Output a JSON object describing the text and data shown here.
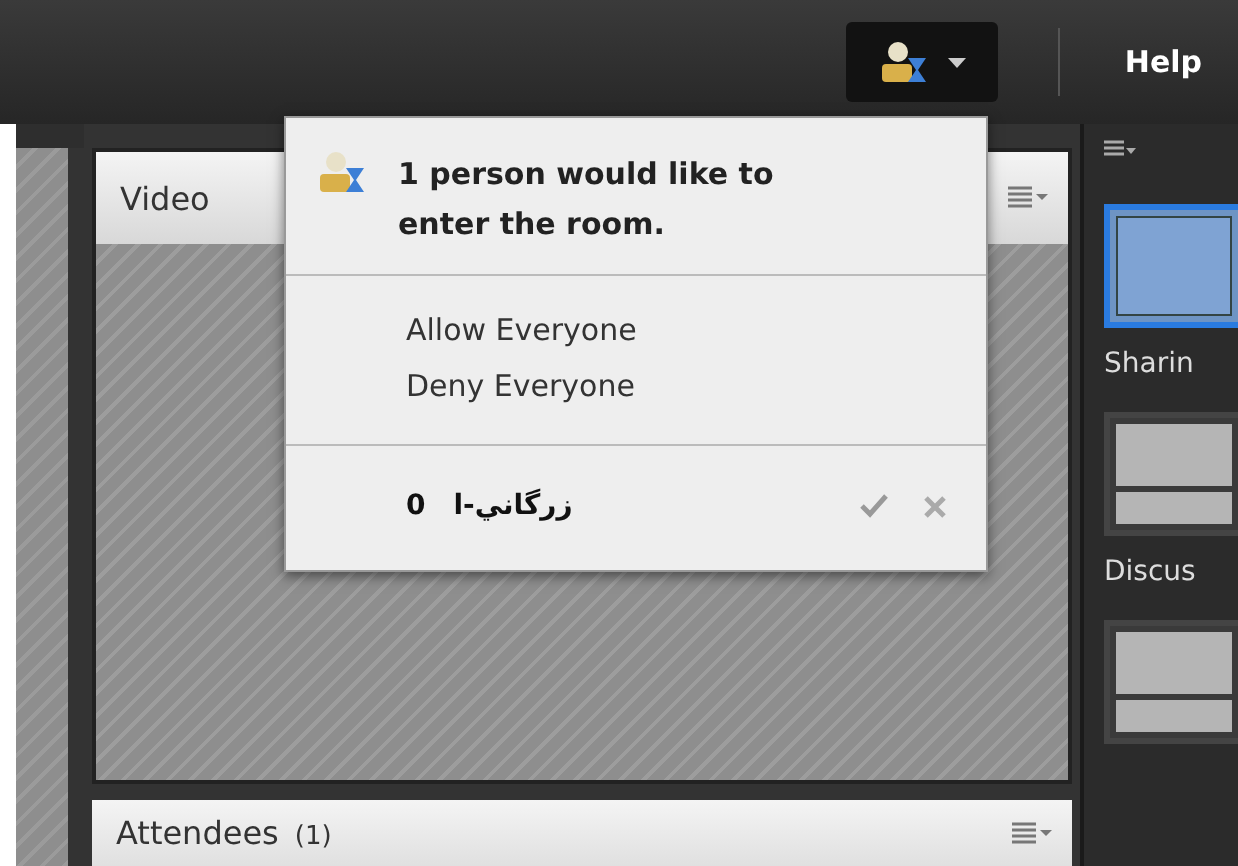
{
  "menubar": {
    "help": "Help",
    "requests_button": {
      "expanded": true
    }
  },
  "video_panel": {
    "title": "Video"
  },
  "attendees_panel": {
    "title": "Attendees",
    "count": "(1)"
  },
  "layouts": [
    {
      "label": "Sharin",
      "kind": "sharing",
      "selected": true
    },
    {
      "label": "Discus",
      "kind": "discussion",
      "selected": false
    },
    {
      "kind": "discussion",
      "selected": false
    }
  ],
  "popup": {
    "message": "1 person would like to enter the room.",
    "actions": [
      "Allow Everyone",
      "Deny Everyone"
    ],
    "requests": [
      {
        "name": "زرگاني-ا",
        "count": "0"
      }
    ]
  }
}
